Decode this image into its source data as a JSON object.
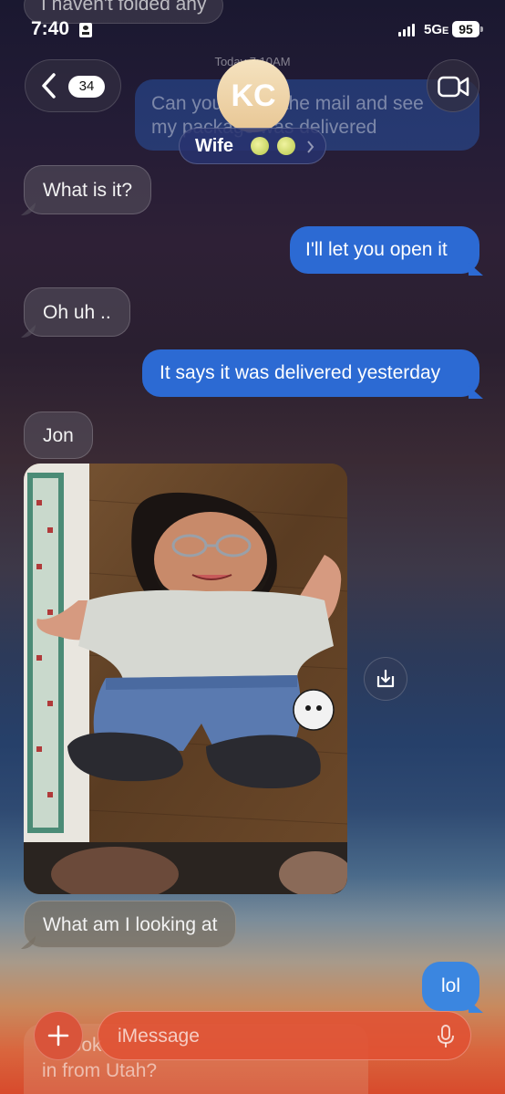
{
  "status_bar": {
    "time": "7:40",
    "network": "5G",
    "network_suffix": "E",
    "battery": "95"
  },
  "header": {
    "back_count": "34",
    "avatar_initials": "KC",
    "contact_name": "Wife",
    "timestamp": "Today 7:10AM"
  },
  "top_faded": {
    "text": "I haven't folded any"
  },
  "messages": [
    {
      "type": "outgoing-faded",
      "text_line1": "Can you check the mail and see",
      "text_line2": "my package was delivered"
    },
    {
      "type": "incoming",
      "text": "What is it?"
    },
    {
      "type": "outgoing",
      "text": "I'll let you open it"
    },
    {
      "type": "incoming",
      "text": "Oh uh .."
    },
    {
      "type": "outgoing",
      "text": "It says it was delivered yesterday"
    },
    {
      "type": "incoming",
      "text": "Jon"
    },
    {
      "type": "incoming",
      "text": "What am I looking at"
    },
    {
      "type": "outgoing",
      "text": "lol"
    }
  ],
  "bottom_faded": {
    "text_line1": "Look",
    "text_line2": "in from Utah?"
  },
  "composer": {
    "placeholder": "iMessage"
  },
  "colors": {
    "outgoing_bubble": "#2c6ad3",
    "incoming_bubble": "rgba(90,84,96,0.55)"
  }
}
